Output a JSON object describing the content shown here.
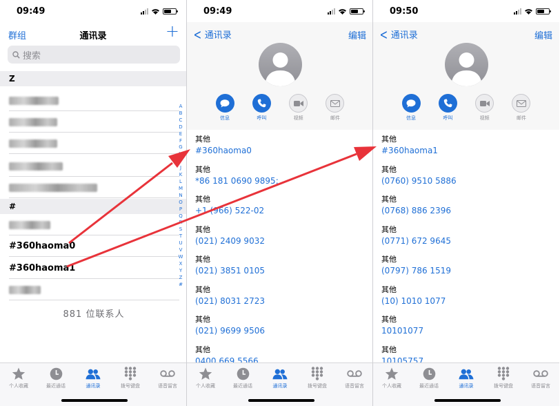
{
  "colors": {
    "accent": "#1f6fd6",
    "arrow": "#e8333a",
    "section_bg": "#ededf0",
    "tabbar_bg": "#f7f7f9"
  },
  "contacts_screen": {
    "status_time": "09:49",
    "nav": {
      "left": "群组",
      "title": "通讯录",
      "right_icon": "plus-icon"
    },
    "search": {
      "placeholder": "搜索"
    },
    "sections": [
      {
        "letter": "Z",
        "blurred_rows": 5
      },
      {
        "letter": "#",
        "rows": [
          "#360haoma0",
          "#360haoma1"
        ]
      }
    ],
    "count": "881 位联系人",
    "alpha_index": [
      "A",
      "B",
      "C",
      "D",
      "E",
      "F",
      "G",
      "H",
      "I",
      "J",
      "K",
      "L",
      "M",
      "N",
      "O",
      "P",
      "Q",
      "R",
      "S",
      "T",
      "U",
      "V",
      "W",
      "X",
      "Y",
      "Z",
      "#"
    ]
  },
  "detail_screen_1": {
    "status_time": "09:49",
    "nav": {
      "back": "通讯录",
      "edit": "编辑"
    },
    "actions": [
      "信息",
      "呼叫",
      "视频",
      "邮件"
    ],
    "fields": [
      {
        "label": "其他",
        "value": "#360haoma0"
      },
      {
        "label": "其他",
        "value": "*86 181 0690 9895;"
      },
      {
        "label": "其他",
        "value": "+1 (966) 522-02"
      },
      {
        "label": "其他",
        "value": "(021) 2409 9032"
      },
      {
        "label": "其他",
        "value": "(021) 3851 0105"
      },
      {
        "label": "其他",
        "value": "(021) 8031 2723"
      },
      {
        "label": "其他",
        "value": "(021) 9699 9506"
      },
      {
        "label": "其他",
        "value": "0400 669 5566"
      }
    ]
  },
  "detail_screen_2": {
    "status_time": "09:50",
    "nav": {
      "back": "通讯录",
      "edit": "编辑"
    },
    "actions": [
      "信息",
      "呼叫",
      "视频",
      "邮件"
    ],
    "fields": [
      {
        "label": "其他",
        "value": "#360haoma1"
      },
      {
        "label": "其他",
        "value": "(0760) 9510 5886"
      },
      {
        "label": "其他",
        "value": "(0768) 886 2396"
      },
      {
        "label": "其他",
        "value": "(0771) 672 9645"
      },
      {
        "label": "其他",
        "value": "(0797) 786 1519"
      },
      {
        "label": "其他",
        "value": "(10) 1010 1077"
      },
      {
        "label": "其他",
        "value": "10101077"
      },
      {
        "label": "其他",
        "value": "10105757"
      }
    ]
  },
  "tab_bar": [
    {
      "label": "个人收藏",
      "icon": "star-icon"
    },
    {
      "label": "最近通话",
      "icon": "clock-icon"
    },
    {
      "label": "通讯录",
      "icon": "contacts-icon",
      "active": true
    },
    {
      "label": "拨号键盘",
      "icon": "keypad-icon"
    },
    {
      "label": "语音留言",
      "icon": "voicemail-icon"
    }
  ]
}
